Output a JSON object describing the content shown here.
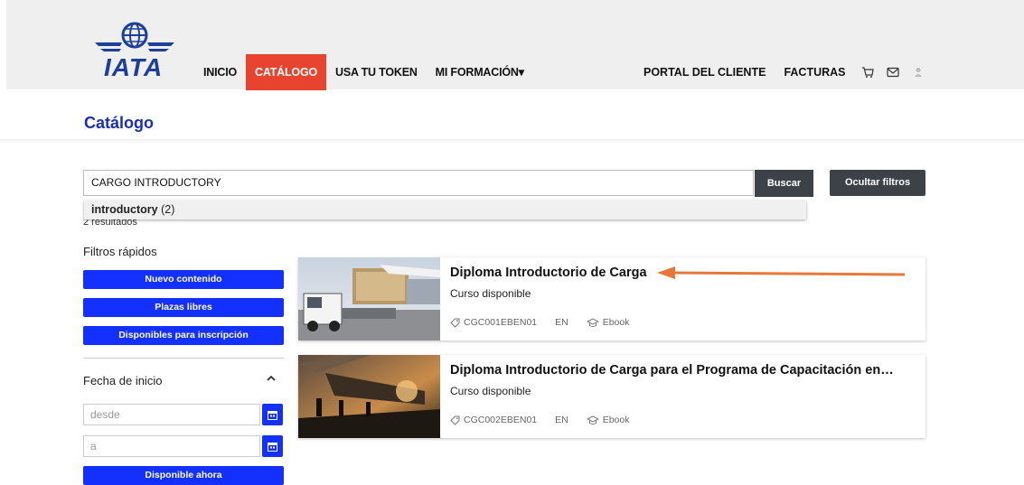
{
  "header": {
    "logo_text": "IATA",
    "nav": [
      {
        "label": "INICIO"
      },
      {
        "label": "CATÁLOGO"
      },
      {
        "label": "USA TU TOKEN"
      },
      {
        "label": "MI FORMACIÓN▾"
      }
    ],
    "right_nav": [
      {
        "label": "PORTAL DEL CLIENTE"
      },
      {
        "label": "FACTURAS"
      }
    ],
    "icons": [
      "cart-icon",
      "mail-icon",
      "user-icon"
    ]
  },
  "page": {
    "title": "Catálogo"
  },
  "search": {
    "value": "CARGO INTRODUCTORY",
    "button": "Buscar",
    "toggle_filters": "Ocultar filtros",
    "suggestion_term": "introductory",
    "suggestion_count": " (2)",
    "results_count": "2 resultados"
  },
  "filters": {
    "quick_label": "Filtros rápidos",
    "quick": [
      "Nuevo contenido",
      "Plazas libres",
      "Disponibles para inscripción"
    ],
    "date_label": "Fecha de inicio",
    "from_placeholder": "desde",
    "to_placeholder": "a",
    "available_now": "Disponible ahora"
  },
  "results": [
    {
      "title": "Diploma Introductorio de Carga",
      "status": "Curso disponible",
      "code": "CGC001EBEN01",
      "lang": "EN",
      "format": "Ebook"
    },
    {
      "title": "Diploma Introductorio de Carga para el Programa de Capacitación en…",
      "status": "Curso disponible",
      "code": "CGC002EBEN01",
      "lang": "EN",
      "format": "Ebook"
    }
  ],
  "colors": {
    "brand_blue": "#1a2fb5",
    "button_blue": "#1330ff",
    "active_nav": "#e8432f",
    "dark_button": "#3d4248",
    "annotation_arrow": "#e8773a"
  }
}
